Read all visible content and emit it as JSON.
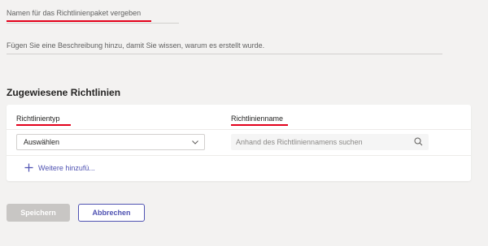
{
  "form": {
    "name_placeholder": "Namen für das Richtlinienpaket vergeben",
    "description_placeholder": "Fügen Sie eine Beschreibung hinzu, damit Sie wissen, warum es erstellt wurde."
  },
  "assigned": {
    "title": "Zugewiesene Richtlinien",
    "col_type": "Richtlinientyp",
    "col_name": "Richtlinienname",
    "select_value": "Auswählen",
    "search_placeholder": "Anhand des Richtliniennamens suchen",
    "add_more_label": "Weitere hinzufü..."
  },
  "actions": {
    "save_label": "Speichern",
    "cancel_label": "Abbrechen"
  },
  "icons": {
    "chevron": "chevron-down-icon",
    "search": "search-icon",
    "plus": "plus-icon"
  },
  "colors": {
    "accent": "#4f52b2",
    "annotation_red": "#e3001b",
    "disabled_button": "#c8c6c4",
    "background": "#f3f2f1"
  }
}
